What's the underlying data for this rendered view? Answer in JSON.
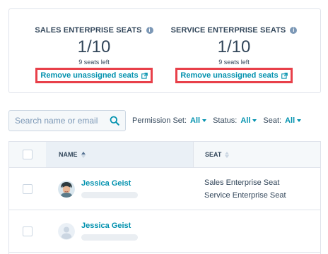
{
  "seats": [
    {
      "title": "SALES ENTERPRISE SEATS",
      "count": "1/10",
      "left": "9 seats left",
      "action": "Remove unassigned seats"
    },
    {
      "title": "SERVICE ENTERPRISE SEATS",
      "count": "1/10",
      "left": "9 seats left",
      "action": "Remove unassigned seats"
    }
  ],
  "search": {
    "placeholder": "Search name or email"
  },
  "filters": [
    {
      "label": "Permission Set:",
      "value": "All"
    },
    {
      "label": "Status:",
      "value": "All"
    },
    {
      "label": "Seat:",
      "value": "All"
    }
  ],
  "table": {
    "headers": {
      "name": "NAME",
      "seat": "SEAT"
    },
    "rows": [
      {
        "name": "Jessica Geist",
        "seat_lines": [
          "Sales Enterprise Seat",
          "Service Enterprise Seat"
        ]
      },
      {
        "name": "Jessica Geist",
        "seat_lines": []
      }
    ]
  },
  "colors": {
    "link": "#0091ae",
    "highlight": "#e8404a",
    "text": "#33475b"
  },
  "icons": [
    "info-icon",
    "external-link-icon",
    "search-icon",
    "sort-icon",
    "user-avatar-icon"
  ]
}
